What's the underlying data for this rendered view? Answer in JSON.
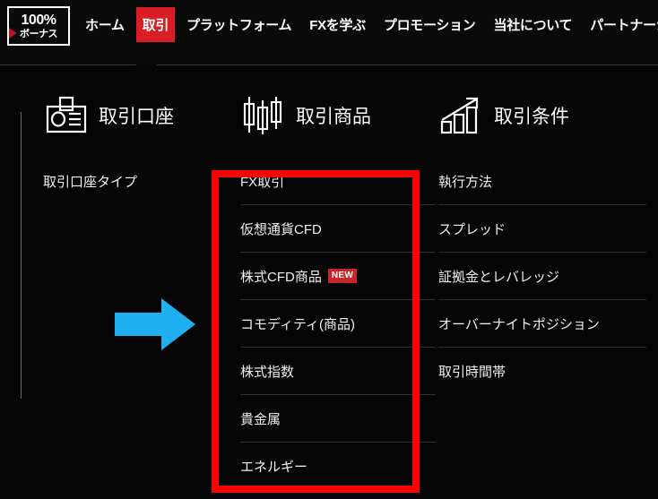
{
  "header": {
    "logo": {
      "name": "bonus-logo",
      "percent": "100%",
      "bonus": "ボーナス"
    },
    "nav_items": [
      {
        "label": "ホーム",
        "active": false
      },
      {
        "label": "取引",
        "active": true
      },
      {
        "label": "プラットフォーム",
        "active": false
      },
      {
        "label": "FXを学ぶ",
        "active": false
      },
      {
        "label": "プロモーション",
        "active": false
      },
      {
        "label": "当社について",
        "active": false
      },
      {
        "label": "パートナーシップ",
        "active": false
      }
    ],
    "active_nav_label": "取引"
  },
  "dropdown": {
    "columns": [
      {
        "icon": "id-card-icon",
        "title": "取引口座",
        "items": [
          {
            "label": "取引口座タイプ",
            "badge": ""
          }
        ]
      },
      {
        "icon": "candlestick-chart-icon",
        "title": "取引商品",
        "items": [
          {
            "label": "FX取引",
            "badge": ""
          },
          {
            "label": "仮想通貨CFD",
            "badge": ""
          },
          {
            "label": "株式CFD商品",
            "badge": "NEW"
          },
          {
            "label": "コモディティ(商品)",
            "badge": ""
          },
          {
            "label": "株式指数",
            "badge": ""
          },
          {
            "label": "貴金属",
            "badge": ""
          },
          {
            "label": "エネルギー",
            "badge": ""
          }
        ]
      },
      {
        "icon": "growth-bar-chart-icon",
        "title": "取引条件",
        "items": [
          {
            "label": "執行方法",
            "badge": ""
          },
          {
            "label": "スプレッド",
            "badge": ""
          },
          {
            "label": "証拠金とレバレッジ",
            "badge": ""
          },
          {
            "label": "オーバーナイトポジション",
            "badge": ""
          },
          {
            "label": "取引時間帯",
            "badge": ""
          }
        ]
      }
    ]
  },
  "annotations": {
    "highlight_rect": {
      "name": "red-highlight-rectangle"
    },
    "pointer_arrow": {
      "name": "blue-arrow-annotation"
    }
  },
  "colors": {
    "background": "#050505",
    "accent_red": "#d81e24",
    "annotation_red": "#fb0000",
    "badge_red": "#c8252b",
    "arrow_blue": "#1eb0f0",
    "text": "#ffffff",
    "divider": "#313131"
  }
}
